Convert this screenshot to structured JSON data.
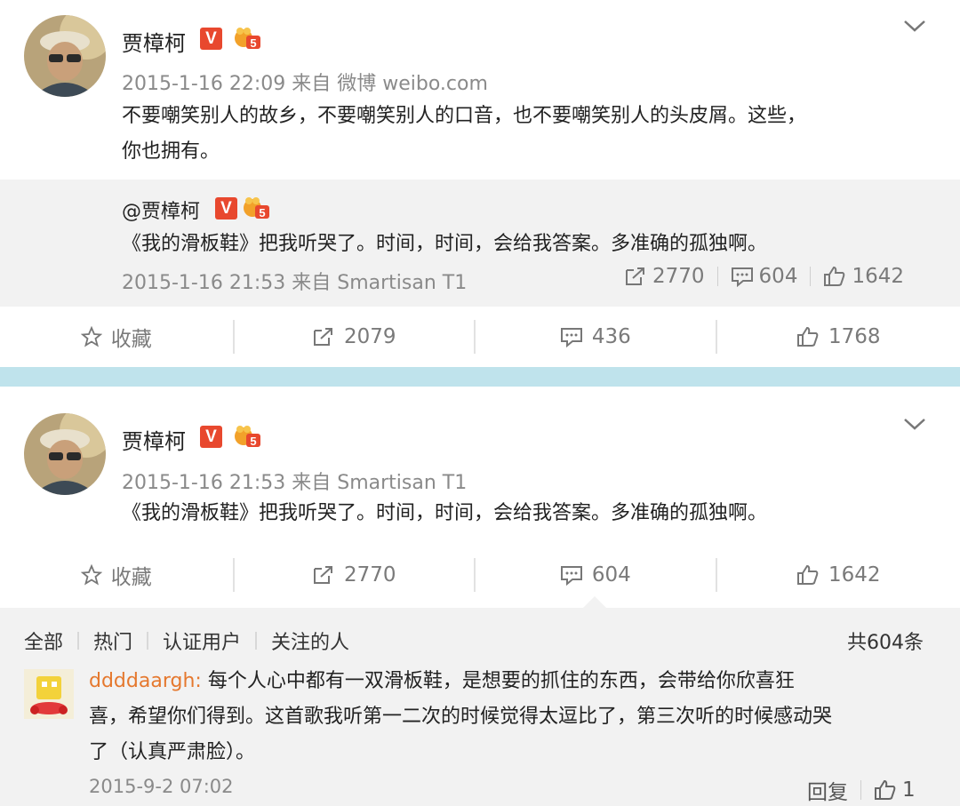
{
  "post1": {
    "author": "贾樟柯",
    "vip_badge": "V",
    "level": "5",
    "meta": "2015-1-16 22:09 来自 微博 weibo.com",
    "text_line1": "不要嘲笑别人的故乡，不要嘲笑别人的口音，也不要嘲笑别人的头皮屑。这些，",
    "text_line2": "你也拥有。",
    "quoted": {
      "author": "@贾樟柯",
      "text": "《我的滑板鞋》把我听哭了。时间，时间，会给我答案。多准确的孤独啊。",
      "meta": "2015-1-16 21:53 来自 Smartisan T1",
      "reposts": "2770",
      "comments": "604",
      "likes": "1642"
    },
    "actions": {
      "favorite": "收藏",
      "reposts": "2079",
      "comments": "436",
      "likes": "1768"
    }
  },
  "post2": {
    "author": "贾樟柯",
    "vip_badge": "V",
    "level": "5",
    "meta": "2015-1-16 21:53 来自 Smartisan T1",
    "text": "《我的滑板鞋》把我听哭了。时间，时间，会给我答案。多准确的孤独啊。",
    "actions": {
      "favorite": "收藏",
      "reposts": "2770",
      "comments": "604",
      "likes": "1642"
    }
  },
  "comments_panel": {
    "tabs": [
      "全部",
      "热门",
      "认证用户",
      "关注的人"
    ],
    "total": "共604条",
    "comment": {
      "user": "ddddaargh",
      "colon": ":",
      "text_line1": "每个人心中都有一双滑板鞋，是想要的抓住的东西，会带给你欣喜狂",
      "text_line2": "喜，希望你们得到。这首歌我听第一二次的时候觉得太逗比了，第三次听的时候感动哭",
      "text_line3": "了（认真严肃脸）。",
      "time": "2015-9-2 07:02",
      "reply": "回复",
      "likes": "1"
    }
  },
  "colors": {
    "separator": "#bfe3ec",
    "vip": "#e8482e",
    "username_link": "#e5782e"
  }
}
